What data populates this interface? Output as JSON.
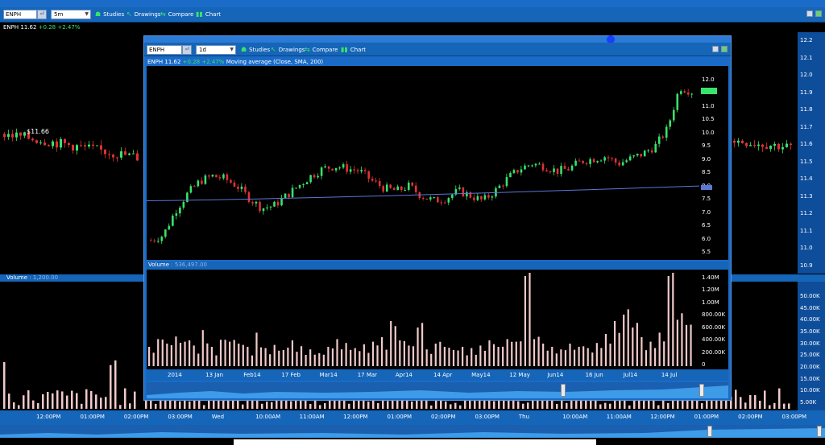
{
  "outer": {
    "toolbar": {
      "symbol": "ENPH",
      "interval": "5m",
      "studies_label": "Studies",
      "drawings_label": "Drawings",
      "compare_label": "Compare",
      "chart_label": "Chart"
    },
    "info": {
      "symbol": "ENPH",
      "price": "11.62",
      "change": "+0.28",
      "change_pct": "+2.47%"
    },
    "price_callout": "$11.66",
    "volume_header": {
      "label": "Volume",
      "value": "1,200.00"
    },
    "price_axis": [
      "12.2",
      "12.1",
      "12.0",
      "11.9",
      "11.8",
      "11.7",
      "11.6",
      "11.5",
      "11.4",
      "11.3",
      "11.2",
      "11.1",
      "11.0",
      "10.9"
    ],
    "volume_axis": [
      "50.00K",
      "45.00K",
      "40.00K",
      "35.00K",
      "30.00K",
      "25.00K",
      "20.00K",
      "15.00K",
      "10.00K",
      "5.00K"
    ],
    "time_axis": [
      "12:00PM",
      "01:00PM",
      "02:00PM",
      "03:00PM",
      "Wed",
      "10:00AM",
      "11:00AM",
      "12:00PM",
      "01:00PM",
      "02:00PM",
      "03:00PM",
      "Thu",
      "10:00AM",
      "11:00AM",
      "12:00PM",
      "01:00PM",
      "02:00PM",
      "03:00PM"
    ]
  },
  "inner": {
    "toolbar": {
      "symbol": "ENPH",
      "interval": "1d",
      "studies_label": "Studies",
      "drawings_label": "Drawings",
      "compare_label": "Compare",
      "chart_label": "Chart"
    },
    "info": {
      "symbol": "ENPH",
      "price": "11.62",
      "change": "+0.28",
      "change_pct": "+2.47%",
      "study": "Moving average (Close, SMA, 200)"
    },
    "volume_header": {
      "label": "Volume",
      "value": "536,497.00"
    },
    "price_axis": [
      "12.0",
      "11.5",
      "11.0",
      "10.5",
      "10.0",
      "9.5",
      "9.0",
      "8.5",
      "8.0",
      "7.5",
      "7.0",
      "6.5",
      "6.0",
      "5.5"
    ],
    "volume_axis": [
      "1.40M",
      "1.20M",
      "1.00M",
      "800.00K",
      "600.00K",
      "400.00K",
      "200.00K",
      "0"
    ],
    "time_axis": [
      "2014",
      "13 Jan",
      "Feb14",
      "17 Feb",
      "Mar14",
      "17 Mar",
      "Apr14",
      "14 Apr",
      "May14",
      "12 May",
      "Jun14",
      "16 Jun",
      "Jul14",
      "14 Jul"
    ]
  },
  "colors": {
    "frame": "#1565b8",
    "up": "#39e26a",
    "down": "#e03232",
    "volume_bar": "#f2c9c9",
    "ma_line": "#5a78d8"
  },
  "chart_data": [
    {
      "type": "candlestick",
      "title": "",
      "series": [
        {
          "name": "ENPH",
          "interval": "1d"
        },
        {
          "name": "Moving average (Close, SMA, 200)",
          "values": [
            7.2,
            7.8
          ]
        }
      ],
      "x": [
        "2014",
        "13 Jan",
        "Feb14",
        "17 Feb",
        "Mar14",
        "17 Mar",
        "Apr14",
        "14 Apr",
        "May14",
        "12 May",
        "Jun14",
        "16 Jun",
        "Jul14",
        "14 Jul"
      ],
      "close_path": [
        5.6,
        5.8,
        6.8,
        7.5,
        8.0,
        8.2,
        8.1,
        7.8,
        7.3,
        6.9,
        7.0,
        7.4,
        7.8,
        8.2,
        8.5,
        8.6,
        8.5,
        8.4,
        8.0,
        7.7,
        7.6,
        7.8,
        7.4,
        7.2,
        7.3,
        7.6,
        7.4,
        7.2,
        7.6,
        8.1,
        8.5,
        8.7,
        8.6,
        8.4,
        8.5,
        8.8,
        8.9,
        9.0,
        8.7,
        8.9,
        9.1,
        9.4,
        10.1,
        11.8,
        11.62
      ],
      "ylim": [
        5.0,
        12.2
      ]
    },
    {
      "type": "bar",
      "title": "",
      "series": [
        {
          "name": "Volume"
        }
      ],
      "ylim": [
        0,
        1400000
      ],
      "values": [
        300000,
        420000,
        350000,
        460000,
        380000,
        320000,
        560000,
        300000,
        410000,
        380000,
        350000,
        300000,
        520000,
        280000,
        330000,
        250000,
        400000,
        310000,
        260000,
        200000,
        300000,
        420000,
        360000,
        280000,
        340000,
        380000,
        450000,
        700000,
        400000,
        320000,
        600000,
        260000,
        350000,
        300000,
        250000,
        300000,
        280000,
        320000,
        400000,
        300000,
        420000,
        380000,
        1400000,
        420000,
        350000,
        300000,
        260000,
        350000,
        300000,
        280000,
        360000,
        500000,
        700000,
        800000,
        600000,
        450000,
        380000,
        520000,
        1400000,
        720000,
        640000
      ]
    }
  ]
}
